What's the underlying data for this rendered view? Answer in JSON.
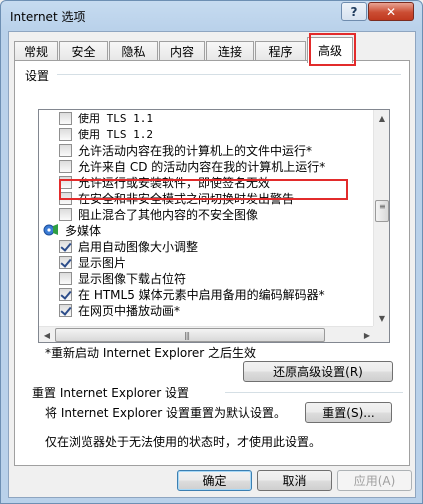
{
  "window": {
    "title": "Internet 选项",
    "help_label": "?",
    "close_label": "✕"
  },
  "tabs": [
    {
      "label": "常规"
    },
    {
      "label": "安全"
    },
    {
      "label": "隐私"
    },
    {
      "label": "内容"
    },
    {
      "label": "连接"
    },
    {
      "label": "程序"
    },
    {
      "label": "高级",
      "active": true
    }
  ],
  "settings": {
    "group_label": "设置",
    "items": [
      {
        "label": "使用 TLS 1.1",
        "type": "checkbox",
        "checked": false
      },
      {
        "label": "使用 TLS 1.2",
        "type": "checkbox",
        "checked": false
      },
      {
        "label": "允许活动内容在我的计算机上的文件中运行*",
        "type": "checkbox",
        "checked": false,
        "highlighted": true
      },
      {
        "label": "允许来自 CD 的活动内容在我的计算机上运行*",
        "type": "checkbox",
        "checked": false
      },
      {
        "label": "允许运行或安装软件，即使签名无效",
        "type": "checkbox",
        "checked": false
      },
      {
        "label": "在安全和非安全模式之间切换时发出警告",
        "type": "checkbox",
        "checked": false
      },
      {
        "label": "阻止混合了其他内容的不安全图像",
        "type": "checkbox",
        "checked": false
      },
      {
        "label": "多媒体",
        "type": "category",
        "icon": "multimedia-icon"
      },
      {
        "label": "启用自动图像大小调整",
        "type": "checkbox",
        "checked": true
      },
      {
        "label": "显示图片",
        "type": "checkbox",
        "checked": true
      },
      {
        "label": "显示图像下载占位符",
        "type": "checkbox",
        "checked": false
      },
      {
        "label": "在 HTML5 媒体元素中启用备用的编码解码器*",
        "type": "checkbox",
        "checked": true
      },
      {
        "label": "在网页中播放动画*",
        "type": "checkbox",
        "checked": true
      }
    ],
    "restart_note": "*重新启动 Internet Explorer 之后生效",
    "restore_button": "还原高级设置(R)"
  },
  "reset": {
    "group_label": "重置 Internet Explorer 设置",
    "description": "将 Internet Explorer 设置重置为默认设置。",
    "reset_button": "重置(S)...",
    "note": "仅在浏览器处于无法使用的状态时，才使用此设置。"
  },
  "footer": {
    "ok": "确定",
    "cancel": "取消",
    "apply": "应用(A)"
  },
  "colors": {
    "highlight": "#e22b2b",
    "title_bar": "#b9d1ea",
    "close_button": "#c0391f"
  }
}
